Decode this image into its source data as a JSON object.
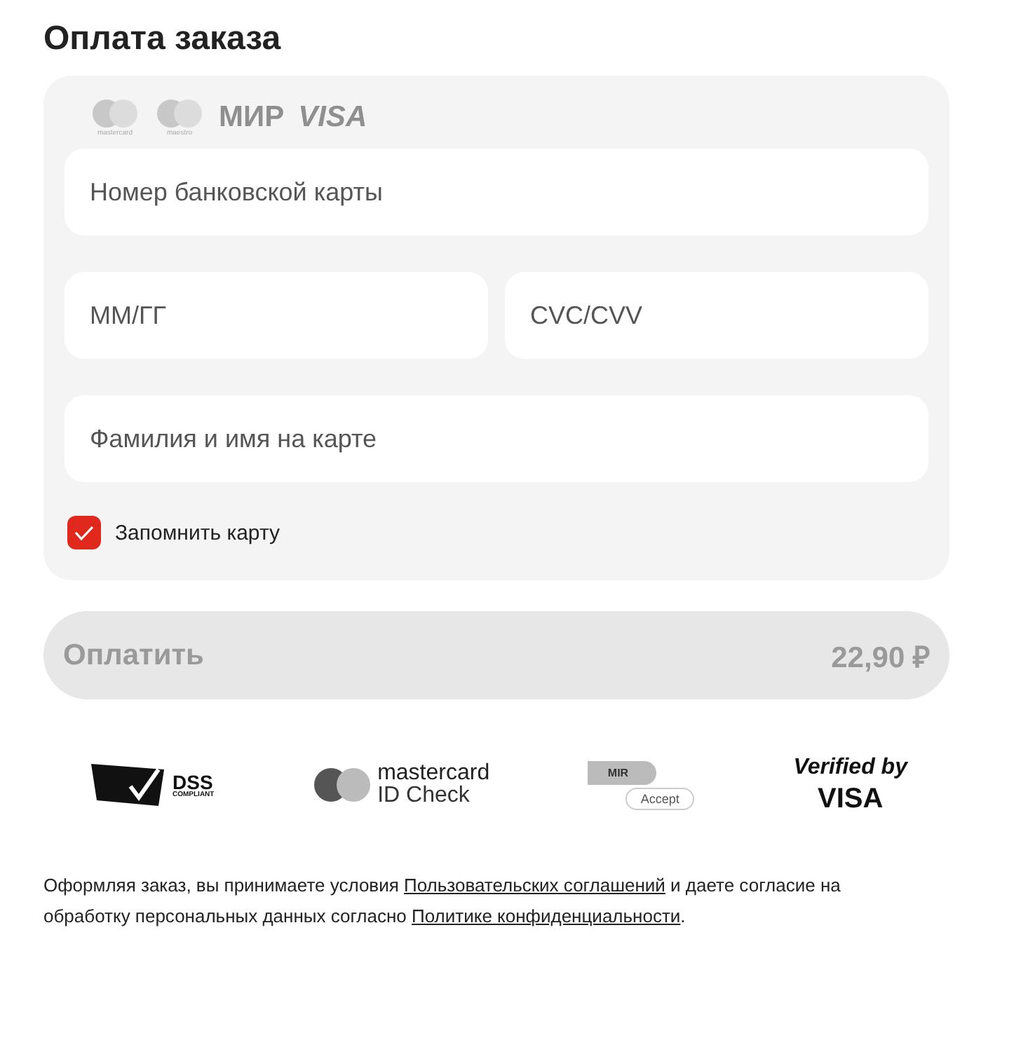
{
  "title": "Оплата заказа",
  "card_logos": [
    {
      "kind": "mastercard",
      "text": "mastercard"
    },
    {
      "kind": "maestro",
      "text": "maestro"
    },
    {
      "kind": "mir",
      "text": "МИР"
    },
    {
      "kind": "visa",
      "text": "VISA"
    }
  ],
  "field_rows": [
    [
      {
        "placeholder": "Номер банковской карты"
      }
    ],
    [
      {
        "placeholder": "ММ/ГГ"
      },
      {
        "placeholder": "CVC/CVV"
      }
    ],
    [
      {
        "placeholder": "Фамилия и имя на карте"
      }
    ]
  ],
  "remember": {
    "label": "Запомнить карту",
    "checked": true
  },
  "pay_button": {
    "label": "Оплатить",
    "amount": "22,90 ₽",
    "disabled": true
  },
  "security_badges": [
    {
      "kind": "pci",
      "texts": [
        "DSS",
        "COMPLIANT"
      ]
    },
    {
      "kind": "mc-id",
      "texts": [
        "mastercard",
        "ID Check"
      ]
    },
    {
      "kind": "mir-accept",
      "texts": [
        "MIR",
        "Accept"
      ]
    },
    {
      "kind": "visa-verified",
      "texts": [
        "Verified by",
        "VISA"
      ]
    }
  ],
  "terms": [
    {
      "kind": "text",
      "text": "Оформляя заказ, вы принимаете условия"
    },
    {
      "kind": "link",
      "text": "Пользовательских соглашений"
    },
    {
      "kind": "text",
      "text": "и даете согласие на обработку персональных данных согласно"
    },
    {
      "kind": "link",
      "text": "Политике конфиденциальности"
    },
    {
      "kind": "text",
      "text": "."
    }
  ]
}
